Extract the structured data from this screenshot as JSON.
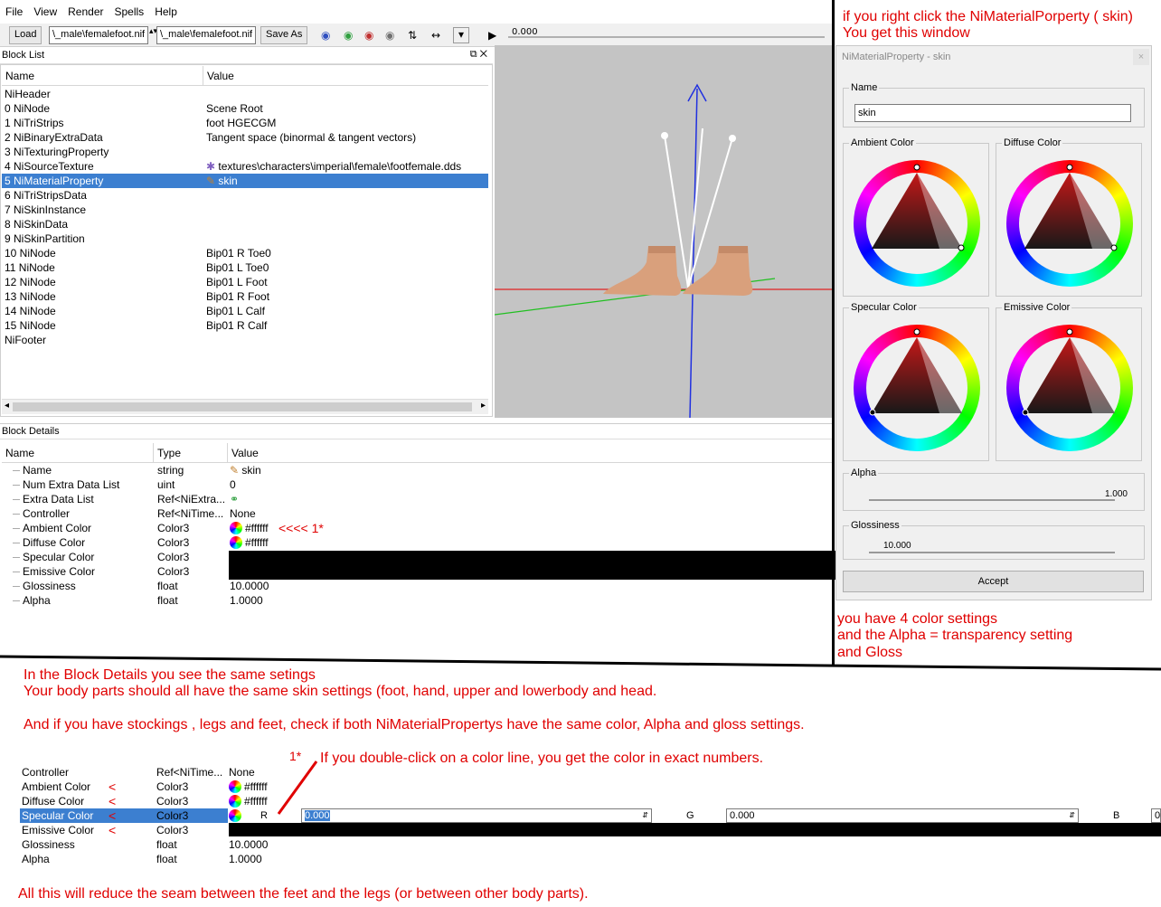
{
  "menu": [
    "File",
    "View",
    "Render",
    "Spells",
    "Help"
  ],
  "toolbar": {
    "load": "Load",
    "file1": "\\_male\\femalefoot.nif",
    "file2": "\\_male\\femalefoot.nif",
    "save_as": "Save As",
    "time_value": "0.000"
  },
  "block_list": {
    "title": "Block List",
    "col_name": "Name",
    "col_value": "Value",
    "rows": [
      {
        "name": "NiHeader",
        "value": ""
      },
      {
        "name": "0  NiNode",
        "value": "Scene Root"
      },
      {
        "name": "1  NiTriStrips",
        "value": "foot HGECGM"
      },
      {
        "name": "2  NiBinaryExtraData",
        "value": "Tangent space (binormal & tangent vectors)"
      },
      {
        "name": "3  NiTexturingProperty",
        "value": ""
      },
      {
        "name": "4  NiSourceTexture",
        "value": "textures\\characters\\imperial\\female\\footfemale.dds"
      },
      {
        "name": "5  NiMaterialProperty",
        "value": "skin"
      },
      {
        "name": "6  NiTriStripsData",
        "value": ""
      },
      {
        "name": "7  NiSkinInstance",
        "value": ""
      },
      {
        "name": "8  NiSkinData",
        "value": ""
      },
      {
        "name": "9  NiSkinPartition",
        "value": ""
      },
      {
        "name": "10 NiNode",
        "value": "Bip01 R Toe0"
      },
      {
        "name": "11 NiNode",
        "value": "Bip01 L Toe0"
      },
      {
        "name": "12 NiNode",
        "value": "Bip01 L Foot"
      },
      {
        "name": "13 NiNode",
        "value": "Bip01 R Foot"
      },
      {
        "name": "14 NiNode",
        "value": "Bip01 L Calf"
      },
      {
        "name": "15 NiNode",
        "value": "Bip01 R Calf"
      },
      {
        "name": "NiFooter",
        "value": ""
      }
    ],
    "selected_index": 6
  },
  "block_details": {
    "title": "Block Details",
    "col_name": "Name",
    "col_type": "Type",
    "col_value": "Value",
    "rows": [
      {
        "name": "Name",
        "type": "string",
        "value": "skin"
      },
      {
        "name": "Num Extra Data List",
        "type": "uint",
        "value": "0"
      },
      {
        "name": "Extra Data List",
        "type": "Ref<NiExtra...",
        "value": ""
      },
      {
        "name": "Controller",
        "type": "Ref<NiTime...",
        "value": "None"
      },
      {
        "name": "Ambient Color",
        "type": "Color3",
        "value": "#ffffff"
      },
      {
        "name": "Diffuse Color",
        "type": "Color3",
        "value": "#ffffff"
      },
      {
        "name": "Specular Color",
        "type": "Color3",
        "value": ""
      },
      {
        "name": "Emissive Color",
        "type": "Color3",
        "value": ""
      },
      {
        "name": "Glossiness",
        "type": "float",
        "value": "10.0000"
      },
      {
        "name": "Alpha",
        "type": "float",
        "value": "1.0000"
      }
    ]
  },
  "dialog": {
    "title": "NiMaterialProperty - skin",
    "close": "×",
    "name_label": "Name",
    "name_value": "skin",
    "ambient_label": "Ambient Color",
    "diffuse_label": "Diffuse Color",
    "specular_label": "Specular Color",
    "emissive_label": "Emissive Color",
    "alpha_label": "Alpha",
    "alpha_value": "1.000",
    "gloss_label": "Glossiness",
    "gloss_value": "10.000",
    "accept": "Accept"
  },
  "annotations": {
    "top_right_1": "if you right click the NiMaterialPorperty ( skin)",
    "top_right_2": "You get this window",
    "arrow_note": "<<<< 1*",
    "right_1": "you have 4 color settings",
    "right_2": "and the Alpha = transparency setting",
    "right_3": "and Gloss",
    "mid_1": "In the Block Details you see the same setings",
    "mid_2": "Your body parts should all have the same skin settings (foot, hand, upper and lowerbody and head.",
    "mid_3": "And if you have stockings , legs and feet,  check if both  NiMaterialPropertys have the same color, Alpha and gloss settings.",
    "footnote_marker": "1*",
    "footnote": "If you double-click on a color line, you get the color in exact numbers.",
    "bottom": "All this will reduce the seam between the feet and the legs (or between other body parts).",
    "lt": "<"
  },
  "zoom": {
    "rows": [
      {
        "name": "Controller",
        "type": "Ref<NiTime...",
        "value": "None"
      },
      {
        "name": "Ambient Color",
        "type": "Color3",
        "value": "#ffffff"
      },
      {
        "name": "Diffuse Color",
        "type": "Color3",
        "value": "#ffffff"
      },
      {
        "name": "Specular Color",
        "type": "Color3",
        "value": ""
      },
      {
        "name": "Emissive Color",
        "type": "Color3",
        "value": ""
      },
      {
        "name": "Glossiness",
        "type": "float",
        "value": "10.0000"
      },
      {
        "name": "Alpha",
        "type": "float",
        "value": "1.0000"
      }
    ],
    "r_label": "R",
    "r_value": "0.000",
    "g_label": "G",
    "g_value": "0.000",
    "b_label": "B",
    "b_value": "0"
  },
  "colors": {
    "selection": "#3c7fd0",
    "annotation": "#e00000",
    "view_bg": "#c4c4c4"
  }
}
